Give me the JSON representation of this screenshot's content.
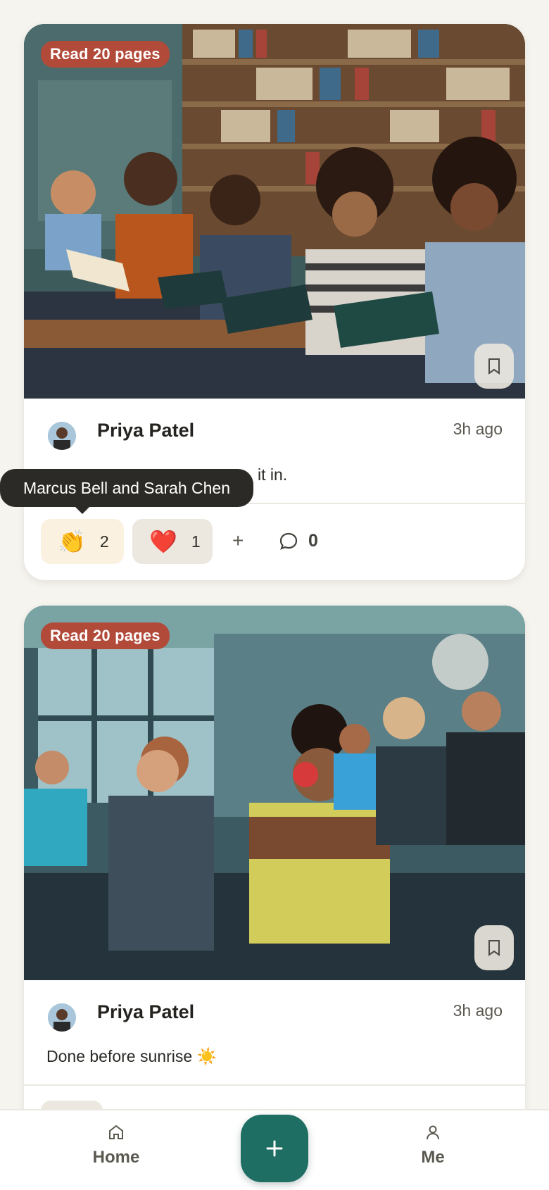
{
  "posts": [
    {
      "badge": "Read 20 pages",
      "author": "Priya Patel",
      "time": "3h ago",
      "caption": "it in.",
      "reactions": [
        {
          "emoji": "👏",
          "count": "2"
        },
        {
          "emoji": "❤️",
          "count": "1"
        }
      ],
      "add_reaction": "+",
      "comment_count": "0"
    },
    {
      "badge": "Read 20 pages",
      "author": "Priya Patel",
      "time": "3h ago",
      "caption": "Done before sunrise ☀️"
    }
  ],
  "tooltip": "Marcus Bell and Sarah Chen",
  "nav": {
    "home": "Home",
    "me": "Me",
    "add": "+"
  },
  "icons": {
    "bookmark": "bookmark-icon",
    "comment": "comment-bubble-icon",
    "home": "home-icon",
    "me": "person-icon",
    "add": "plus-icon"
  },
  "colors": {
    "accent": "#1f6e63",
    "badge": "#b24a3a",
    "background": "#f6f4ef"
  }
}
